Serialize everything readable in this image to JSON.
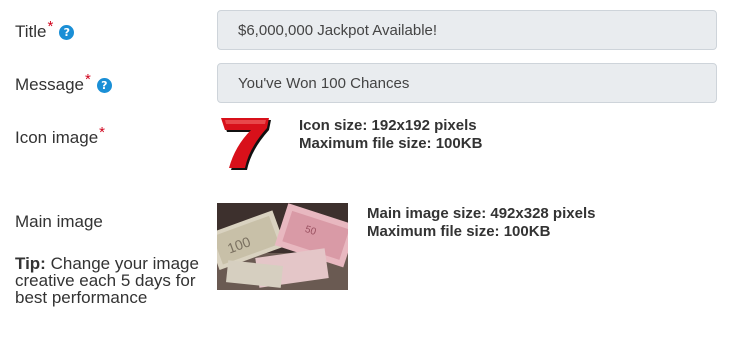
{
  "form": {
    "title": {
      "label": "Title",
      "required_mark": "*",
      "help": "?",
      "value": "$6,000,000 Jackpot Available!"
    },
    "message": {
      "label": "Message",
      "required_mark": "*",
      "help": "?",
      "value": "You've Won 100 Chances"
    },
    "icon_image": {
      "label": "Icon image",
      "required_mark": "*",
      "size_info": "Icon size: 192x192 pixels",
      "max_info": "Maximum file size: 100KB",
      "preview_glyph": "7"
    },
    "main_image": {
      "label": "Main image",
      "size_info": "Main image size: 492x328 pixels",
      "max_info": "Maximum file size: 100KB"
    },
    "tip": {
      "prefix": "Tip:",
      "text": " Change your image creative each 5 days for best performance"
    }
  },
  "colors": {
    "required": "#d0021b",
    "help_icon": "#1a8fd6",
    "field_bg": "#e9ecef",
    "seven_red": "#d8101a"
  }
}
